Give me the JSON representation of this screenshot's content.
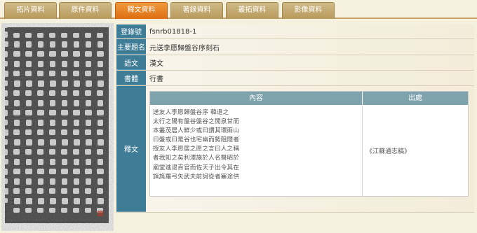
{
  "tabs": [
    {
      "label": "拓片資料",
      "active": false
    },
    {
      "label": "原件資料",
      "active": false
    },
    {
      "label": "釋文資料",
      "active": true
    },
    {
      "label": "著錄資料",
      "active": false
    },
    {
      "label": "叢拓資料",
      "active": false
    },
    {
      "label": "影像資料",
      "active": false
    }
  ],
  "record": {
    "reg_label": "登錄號",
    "reg_value": "fsnrb01818-1",
    "title_label": "主要題名",
    "title_value": "元送李愿歸盤谷序刻石",
    "lang_label": "語文",
    "lang_value": "漢文",
    "script_label": "書體",
    "script_value": "行書",
    "text_label": "釋文"
  },
  "transcription": {
    "content_header": "內容",
    "source_header": "出處",
    "lines": [
      "送友人李愿歸盤谷序 韓退之",
      "太行之陽有盤谷盤谷之閒泉甘而",
      "本叢茂居人鮮少或曰謂其環兩山",
      "曰盤或曰是谷也宅幽而勢阻隱者",
      "授友人李愿居之愿之言曰人之稱",
      "者我知之矣利澤施於人名聲昭於",
      "廟堂進退百官而佐天子出令其在",
      "旗旄羅弓矢武夫前訶從者塞途供"
    ],
    "source": "《江蘇通志稿》"
  },
  "colors": {
    "tab_inactive": "#bca067",
    "tab_active": "#e57a1e",
    "label_bg": "#3f7d97",
    "inner_header_bg": "#7fa3ac"
  }
}
